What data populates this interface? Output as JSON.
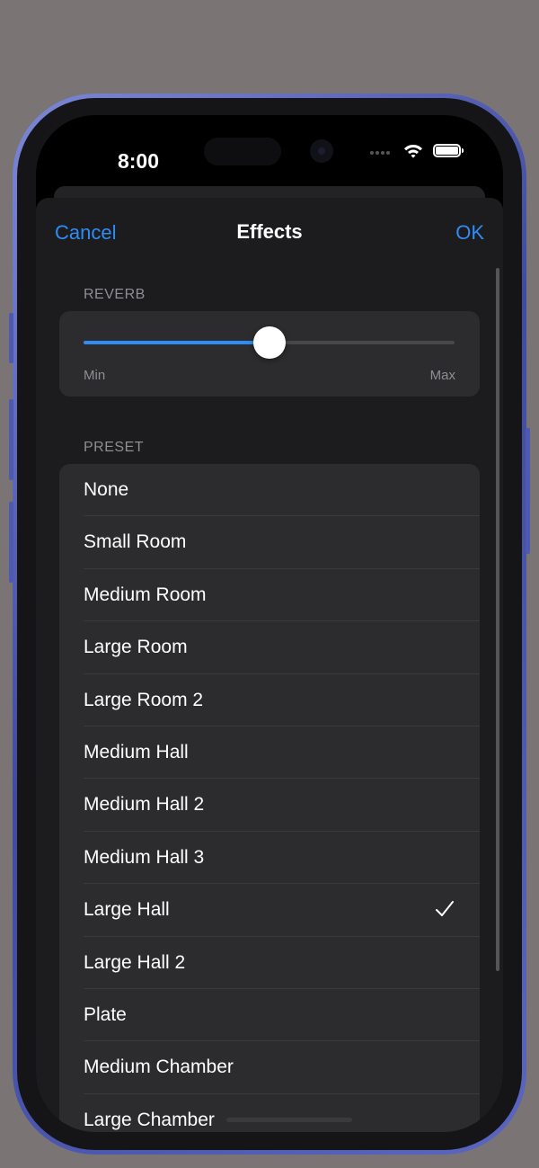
{
  "status_bar": {
    "time": "8:00"
  },
  "nav": {
    "cancel_label": "Cancel",
    "title": "Effects",
    "ok_label": "OK"
  },
  "reverb": {
    "header": "REVERB",
    "min_label": "Min",
    "max_label": "Max",
    "value_fraction": 0.5
  },
  "preset": {
    "header": "PRESET",
    "selected": "Large Hall",
    "items": [
      {
        "label": "None"
      },
      {
        "label": "Small Room"
      },
      {
        "label": "Medium Room"
      },
      {
        "label": "Large Room"
      },
      {
        "label": "Large Room 2"
      },
      {
        "label": "Medium Hall"
      },
      {
        "label": "Medium Hall 2"
      },
      {
        "label": "Medium Hall 3"
      },
      {
        "label": "Large Hall"
      },
      {
        "label": "Large Hall 2"
      },
      {
        "label": "Plate"
      },
      {
        "label": "Medium Chamber"
      },
      {
        "label": "Large Chamber"
      }
    ]
  },
  "colors": {
    "accent": "#2f8cf5",
    "background": "#1c1c1e",
    "card": "#2c2c2e",
    "secondary_text": "#8e8e93",
    "frame": "#4e5ab0"
  },
  "icons": {
    "wifi": "wifi-icon",
    "battery": "battery-icon",
    "signal": "signal-dots-icon",
    "selected_marker": "checkmark-icon"
  }
}
